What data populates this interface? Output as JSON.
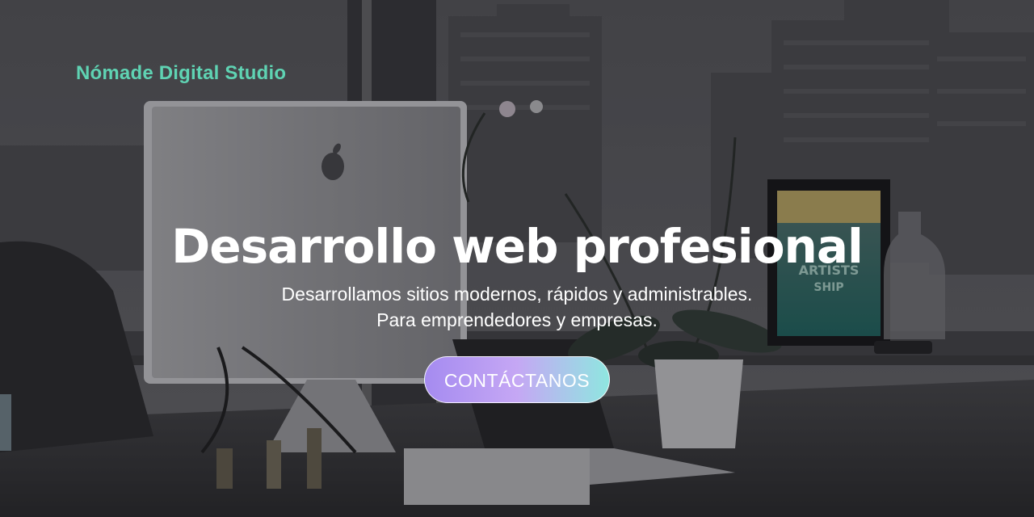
{
  "brand": {
    "name": "Nómade Digital Studio",
    "color": "#5fd3b3"
  },
  "hero": {
    "title": "Desarrollo web profesional",
    "subtitle_line1": "Desarrollamos sitios modernos, rápidos y administrables.",
    "subtitle_line2": "Para emprendedores y empresas.",
    "cta_label": "CONTÁCTANOS",
    "cta_gradient": [
      "#a58bf0",
      "#c5a7f4",
      "#8fe6e0"
    ]
  },
  "background": {
    "description_icon": "office-desk-photo",
    "tint": "#3a3a3e"
  }
}
